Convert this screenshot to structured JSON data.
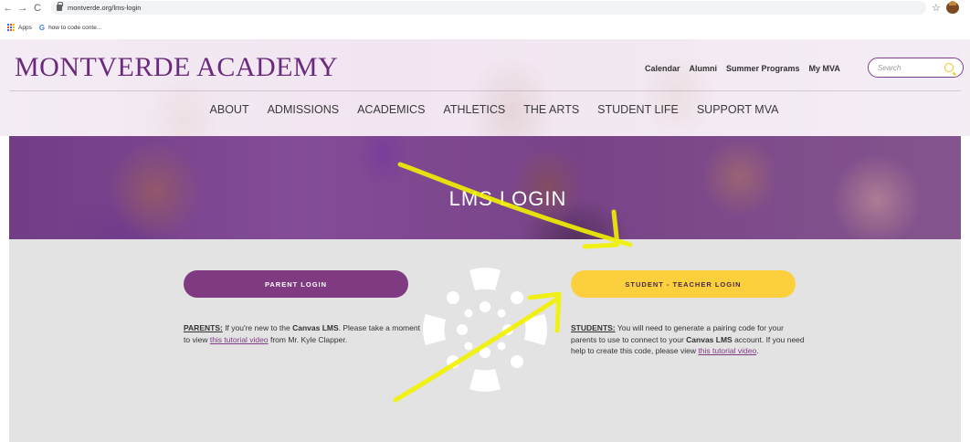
{
  "browser": {
    "url": "montverde.org/lms-login",
    "bookmarks": [
      "Apps",
      "how to code conte..."
    ]
  },
  "header": {
    "logo": "MONTVERDE ACADEMY",
    "top_links": [
      "Calendar",
      "Alumni",
      "Summer Programs",
      "My MVA"
    ],
    "search_placeholder": "Search",
    "nav": [
      "ABOUT",
      "ADMISSIONS",
      "ACADEMICS",
      "ATHLETICS",
      "THE ARTS",
      "STUDENT LIFE",
      "SUPPORT MVA"
    ]
  },
  "hero": {
    "title": "LMS LOGIN"
  },
  "parent": {
    "button": "PARENT LOGIN",
    "lead": "PARENTS:",
    "text1": " If you're new to the ",
    "bold1": "Canvas LMS",
    "text2": ". Please take a moment to view ",
    "link": "this tutorial video",
    "text3": " from Mr. Kyle Clapper."
  },
  "student": {
    "button": "STUDENT - TEACHER LOGIN",
    "lead": "STUDENTS:",
    "text1": " You will need to generate a pairing code for your parents to use to connect to your ",
    "bold1": "Canvas LMS",
    "text2": " account.  If you need help to create this code, please view ",
    "link": "this tutorial video",
    "text3": "."
  },
  "colors": {
    "brand_purple": "#6b2a7d",
    "parent_button": "#7f3a82",
    "student_button": "#fccf3c",
    "annotation": "#f2f200"
  }
}
